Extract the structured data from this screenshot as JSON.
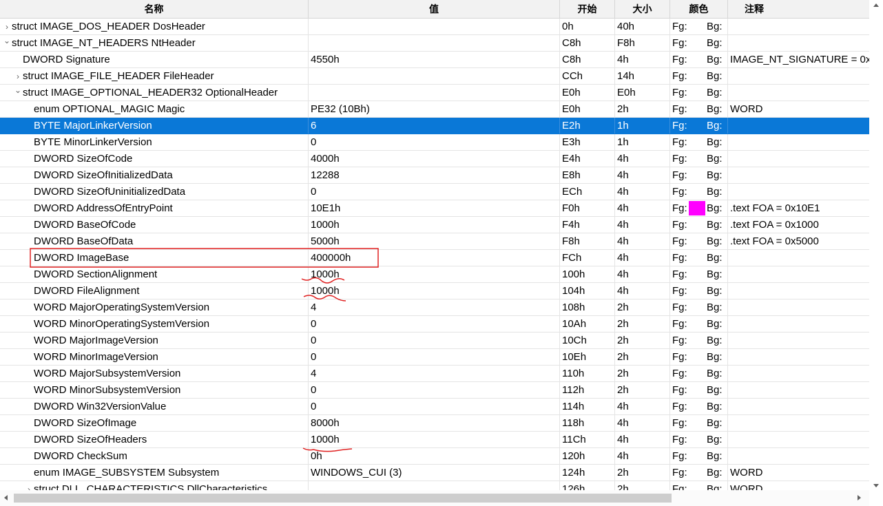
{
  "headers": {
    "name": "名称",
    "value": "值",
    "start": "开始",
    "size": "大小",
    "color": "颜色",
    "note": "注释"
  },
  "fg_label": "Fg:",
  "bg_label": "Bg:",
  "swatch_color": "#ff00ff",
  "selection_color": "#0a78d7",
  "annotation_color": "#e02020",
  "rows": [
    {
      "toggle": ">",
      "name": "struct IMAGE_DOS_HEADER DosHeader",
      "value": "",
      "start": "0h",
      "size": "40h",
      "note": ""
    },
    {
      "toggle": "v",
      "name": "struct IMAGE_NT_HEADERS NtHeader",
      "value": "",
      "start": "C8h",
      "size": "F8h",
      "note": ""
    },
    {
      "toggle": "",
      "name": "DWORD Signature",
      "value": "4550h",
      "start": "C8h",
      "size": "4h",
      "note": "IMAGE_NT_SIGNATURE = 0x"
    },
    {
      "toggle": ">",
      "name": "struct IMAGE_FILE_HEADER FileHeader",
      "value": "",
      "start": "CCh",
      "size": "14h",
      "note": ""
    },
    {
      "toggle": "v",
      "name": "struct IMAGE_OPTIONAL_HEADER32 OptionalHeader",
      "value": "",
      "start": "E0h",
      "size": "E0h",
      "note": ""
    },
    {
      "toggle": "",
      "name": "enum OPTIONAL_MAGIC Magic",
      "value": "PE32 (10Bh)",
      "start": "E0h",
      "size": "2h",
      "note": "WORD"
    },
    {
      "toggle": "",
      "name": "BYTE MajorLinkerVersion",
      "value": "6",
      "start": "E2h",
      "size": "1h",
      "note": ""
    },
    {
      "toggle": "",
      "name": "BYTE MinorLinkerVersion",
      "value": "0",
      "start": "E3h",
      "size": "1h",
      "note": ""
    },
    {
      "toggle": "",
      "name": "DWORD SizeOfCode",
      "value": "4000h",
      "start": "E4h",
      "size": "4h",
      "note": ""
    },
    {
      "toggle": "",
      "name": "DWORD SizeOfInitializedData",
      "value": "12288",
      "start": "E8h",
      "size": "4h",
      "note": ""
    },
    {
      "toggle": "",
      "name": "DWORD SizeOfUninitializedData",
      "value": "0",
      "start": "ECh",
      "size": "4h",
      "note": ""
    },
    {
      "toggle": "",
      "name": "DWORD AddressOfEntryPoint",
      "value": "10E1h",
      "start": "F0h",
      "size": "4h",
      "note": ".text FOA = 0x10E1"
    },
    {
      "toggle": "",
      "name": "DWORD BaseOfCode",
      "value": "1000h",
      "start": "F4h",
      "size": "4h",
      "note": ".text FOA = 0x1000"
    },
    {
      "toggle": "",
      "name": "DWORD BaseOfData",
      "value": "5000h",
      "start": "F8h",
      "size": "4h",
      "note": ".text FOA = 0x5000"
    },
    {
      "toggle": "",
      "name": "DWORD ImageBase",
      "value": "400000h",
      "start": "FCh",
      "size": "4h",
      "note": ""
    },
    {
      "toggle": "",
      "name": "DWORD SectionAlignment",
      "value": "1000h",
      "start": "100h",
      "size": "4h",
      "note": ""
    },
    {
      "toggle": "",
      "name": "DWORD FileAlignment",
      "value": "1000h",
      "start": "104h",
      "size": "4h",
      "note": ""
    },
    {
      "toggle": "",
      "name": "WORD MajorOperatingSystemVersion",
      "value": "4",
      "start": "108h",
      "size": "2h",
      "note": ""
    },
    {
      "toggle": "",
      "name": "WORD MinorOperatingSystemVersion",
      "value": "0",
      "start": "10Ah",
      "size": "2h",
      "note": ""
    },
    {
      "toggle": "",
      "name": "WORD MajorImageVersion",
      "value": "0",
      "start": "10Ch",
      "size": "2h",
      "note": ""
    },
    {
      "toggle": "",
      "name": "WORD MinorImageVersion",
      "value": "0",
      "start": "10Eh",
      "size": "2h",
      "note": ""
    },
    {
      "toggle": "",
      "name": "WORD MajorSubsystemVersion",
      "value": "4",
      "start": "110h",
      "size": "2h",
      "note": ""
    },
    {
      "toggle": "",
      "name": "WORD MinorSubsystemVersion",
      "value": "0",
      "start": "112h",
      "size": "2h",
      "note": ""
    },
    {
      "toggle": "",
      "name": "DWORD Win32VersionValue",
      "value": "0",
      "start": "114h",
      "size": "4h",
      "note": ""
    },
    {
      "toggle": "",
      "name": "DWORD SizeOfImage",
      "value": "8000h",
      "start": "118h",
      "size": "4h",
      "note": ""
    },
    {
      "toggle": "",
      "name": "DWORD SizeOfHeaders",
      "value": "1000h",
      "start": "11Ch",
      "size": "4h",
      "note": ""
    },
    {
      "toggle": "",
      "name": "DWORD CheckSum",
      "value": "0h",
      "start": "120h",
      "size": "4h",
      "note": ""
    },
    {
      "toggle": "",
      "name": "enum IMAGE_SUBSYSTEM Subsystem",
      "value": "WINDOWS_CUI (3)",
      "start": "124h",
      "size": "2h",
      "note": "WORD"
    },
    {
      "toggle": ">",
      "name": "struct DLL_CHARACTERISTICS DllCharacteristics",
      "value": "",
      "start": "126h",
      "size": "2h",
      "note": "WORD"
    }
  ]
}
